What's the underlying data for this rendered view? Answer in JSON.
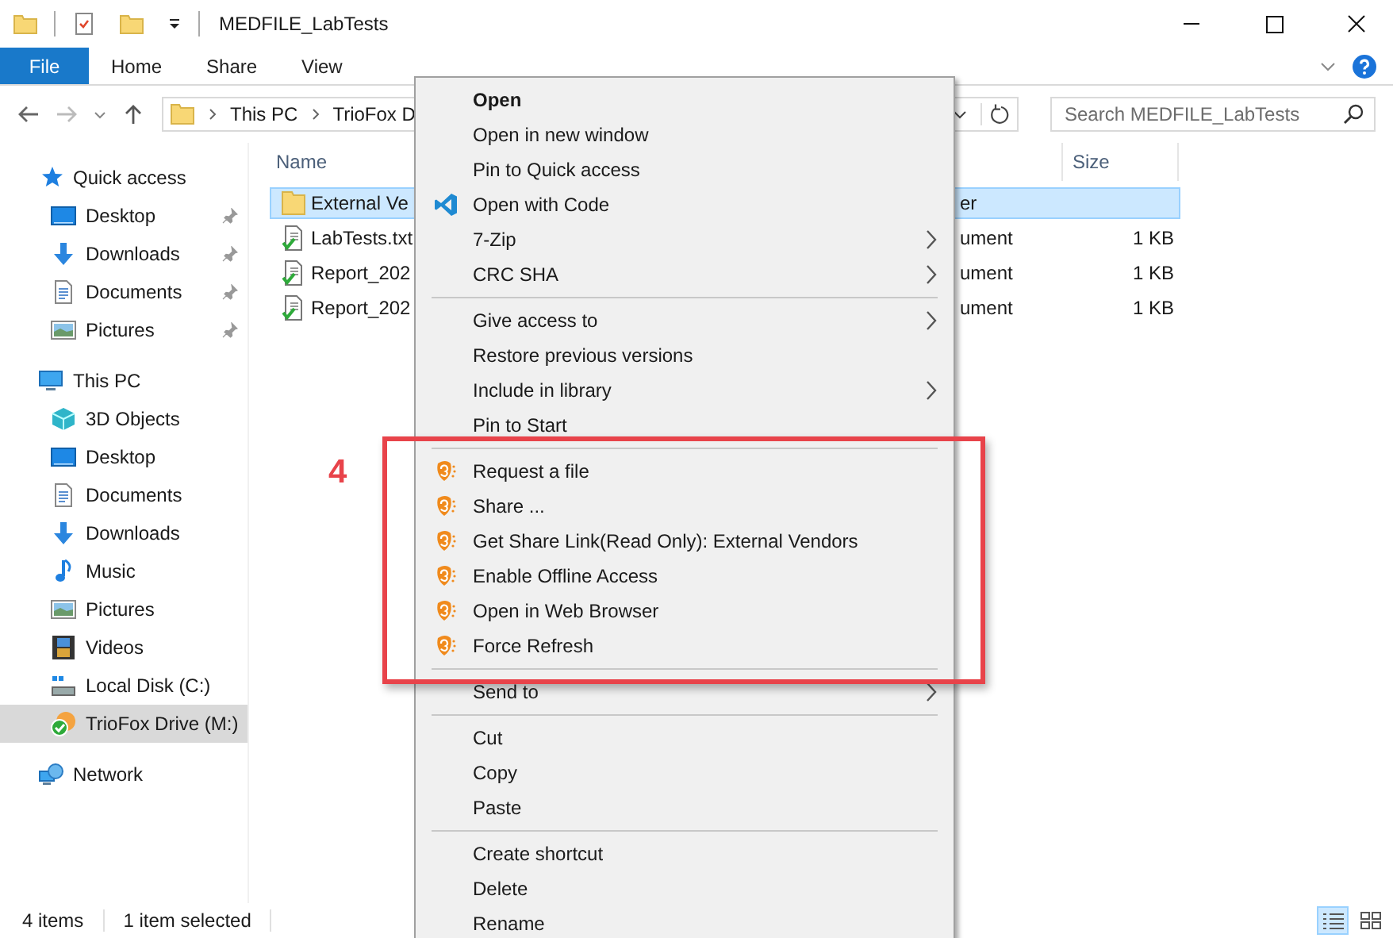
{
  "window": {
    "title": "MEDFILE_LabTests"
  },
  "ribbon_tabs": [
    {
      "label": "File",
      "selected": true
    },
    {
      "label": "Home",
      "selected": false
    },
    {
      "label": "Share",
      "selected": false
    },
    {
      "label": "View",
      "selected": false
    }
  ],
  "address": {
    "crumbs": [
      "This PC",
      "TrioFox D"
    ]
  },
  "search": {
    "placeholder": "Search MEDFILE_LabTests"
  },
  "sidebar": [
    {
      "label": "Quick access",
      "kind": "star",
      "selected": false,
      "children": [
        {
          "label": "Desktop",
          "kind": "desktop",
          "selected": false,
          "pinned": true
        },
        {
          "label": "Downloads",
          "kind": "download",
          "selected": false,
          "pinned": true
        },
        {
          "label": "Documents",
          "kind": "document",
          "selected": false,
          "pinned": true
        },
        {
          "label": "Pictures",
          "kind": "picture",
          "selected": false,
          "pinned": true
        }
      ]
    },
    {
      "label": "This PC",
      "kind": "pc",
      "selected": false,
      "children": [
        {
          "label": "3D Objects",
          "kind": "cube",
          "selected": false
        },
        {
          "label": "Desktop",
          "kind": "desktop",
          "selected": false
        },
        {
          "label": "Documents",
          "kind": "document",
          "selected": false
        },
        {
          "label": "Downloads",
          "kind": "download",
          "selected": false
        },
        {
          "label": "Music",
          "kind": "music",
          "selected": false
        },
        {
          "label": "Pictures",
          "kind": "picture",
          "selected": false
        },
        {
          "label": "Videos",
          "kind": "film",
          "selected": false
        },
        {
          "label": "Local Disk (C:)",
          "kind": "disk",
          "selected": false
        },
        {
          "label": "TrioFox Drive (M:)",
          "kind": "drive",
          "selected": true
        }
      ]
    },
    {
      "label": "Network",
      "kind": "network",
      "selected": false
    }
  ],
  "file_list": {
    "columns": [
      "Name",
      "Size"
    ],
    "rows": [
      {
        "name": "External Ve",
        "type": "er",
        "kind": "folder",
        "selected": true
      },
      {
        "name": "LabTests.txt",
        "type": "ument",
        "size": "1 KB",
        "kind": "synced",
        "selected": false
      },
      {
        "name": "Report_202",
        "type": "ument",
        "size": "1 KB",
        "kind": "synced",
        "selected": false
      },
      {
        "name": "Report_202",
        "type": "ument",
        "size": "1 KB",
        "kind": "synced",
        "selected": false
      }
    ]
  },
  "context_menu": {
    "groups": [
      [
        {
          "label": "Open",
          "default": true,
          "submenu": false
        },
        {
          "label": "Open in new window",
          "default": false,
          "submenu": false
        },
        {
          "label": "Pin to Quick access",
          "default": false,
          "submenu": false
        },
        {
          "label": "Open with Code",
          "kind": "code",
          "default": false,
          "submenu": false
        },
        {
          "label": "7-Zip",
          "default": false,
          "submenu": true
        },
        {
          "label": "CRC SHA",
          "default": false,
          "submenu": true
        }
      ],
      [
        {
          "label": "Give access to",
          "default": false,
          "submenu": true
        },
        {
          "label": "Restore previous versions",
          "default": false,
          "submenu": false
        },
        {
          "label": "Include in library",
          "default": false,
          "submenu": true
        },
        {
          "label": "Pin to Start",
          "default": false,
          "submenu": false
        }
      ],
      [
        {
          "label": "Request a file",
          "kind": "shield",
          "default": false,
          "submenu": false
        },
        {
          "label": "Share ...",
          "kind": "shield",
          "default": false,
          "submenu": false
        },
        {
          "label": "Get Share Link(Read Only): External Vendors",
          "kind": "shield",
          "default": false,
          "submenu": false
        },
        {
          "label": "Enable Offline Access",
          "kind": "shield",
          "default": false,
          "submenu": false
        },
        {
          "label": "Open in Web Browser",
          "kind": "shield",
          "default": false,
          "submenu": false
        },
        {
          "label": "Force Refresh",
          "kind": "shield",
          "default": false,
          "submenu": false
        }
      ],
      [
        {
          "label": "Send to",
          "default": false,
          "submenu": true
        }
      ],
      [
        {
          "label": "Cut",
          "default": false,
          "submenu": false
        },
        {
          "label": "Copy",
          "default": false,
          "submenu": false
        },
        {
          "label": "Paste",
          "default": false,
          "submenu": false
        }
      ],
      [
        {
          "label": "Create shortcut",
          "default": false,
          "submenu": false
        },
        {
          "label": "Delete",
          "default": false,
          "submenu": false
        },
        {
          "label": "Rename",
          "default": false,
          "submenu": false
        }
      ]
    ]
  },
  "annotation": {
    "label": "4"
  },
  "status_bar": {
    "item_count": "4 items",
    "selection": "1 item selected",
    "views": [
      {
        "selected": true
      },
      {
        "selected": false
      }
    ]
  }
}
